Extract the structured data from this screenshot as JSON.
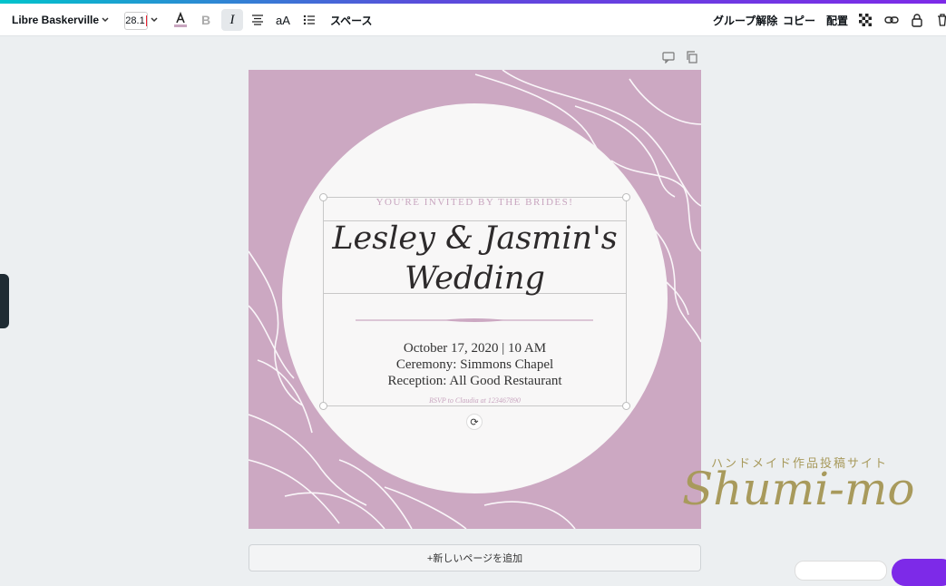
{
  "toolbar": {
    "font_name": "Libre Baskerville",
    "font_size": "28.1",
    "bold_label": "B",
    "italic_label": "I",
    "case_label": "aA",
    "spacing_label": "スペース",
    "ungroup_label": "グループ解除",
    "copy_label": "コピー",
    "arrange_label": "配置"
  },
  "design": {
    "invite_line": "YOU'RE INVITED BY THE BRIDES!",
    "title_line1": "Lesley & Jasmin's",
    "title_line2": "Wedding",
    "date_line": "October 17, 2020 | 10 AM",
    "ceremony_line": "Ceremony: Simmons Chapel",
    "reception_line": "Reception: All Good Restaurant",
    "rsvp_line": "RSVP to Claudia at 123467890"
  },
  "page": {
    "add_page_label": "+新しいページを追加"
  },
  "watermark": {
    "jp_text": "ハンドメイド作品投稿サイト",
    "logo_text": "Shumi-mo"
  },
  "colors": {
    "canvas_bg": "#cca8c2",
    "accent": "#7d2ae8"
  },
  "icons": [
    "chevron-down-icon",
    "text-color-icon",
    "align-center-icon",
    "list-icon",
    "transparency-icon",
    "link-icon",
    "lock-icon",
    "trash-icon",
    "comment-icon",
    "duplicate-icon",
    "rotate-icon"
  ]
}
